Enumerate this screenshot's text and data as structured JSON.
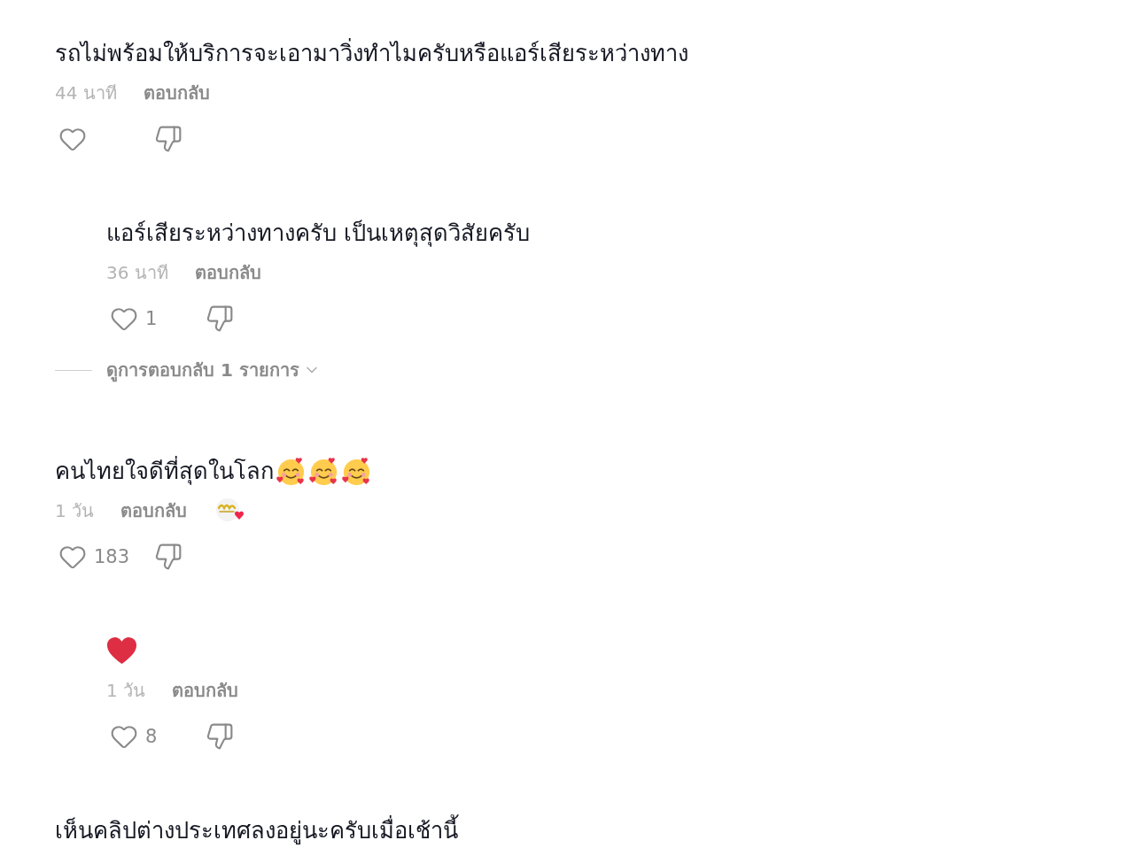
{
  "comments": [
    {
      "text": "รถไม่พร้อมให้บริการจะเอามาวิ่งทำไมครับหรือแอร์เสียระหว่างทาง",
      "time": "44 นาที",
      "reply_label": "ตอบกลับ",
      "liked": false,
      "replies": [
        {
          "text": "แอร์เสียระหว่างทางครับ เป็นเหตุสุดวิสัยครับ",
          "time": "36 นาที",
          "reply_label": "ตอบกลับ",
          "liked": false,
          "likes": "1"
        }
      ],
      "view_replies": "ดูการตอบกลับ 1 รายการ"
    },
    {
      "text": "คนไทยใจดีที่สุดในโลก",
      "emojis": [
        {
          "kind": "smiling_face_with_hearts"
        },
        {
          "kind": "smiling_face_with_hearts"
        },
        {
          "kind": "smiling_face_with_hearts"
        }
      ],
      "time": "1 วัน",
      "reply_label": "ตอบกลับ",
      "sticker": true,
      "liked": false,
      "likes": "183",
      "replies": [
        {
          "emojis": [
            {
              "kind": "red_heart"
            }
          ],
          "time": "1 วัน",
          "reply_label": "ตอบกลับ",
          "liked": false,
          "likes": "8"
        }
      ]
    },
    {
      "text": "เห็นคลิปต่างประเทศลงอยู่นะครับเมื่อเช้านี้"
    }
  ]
}
